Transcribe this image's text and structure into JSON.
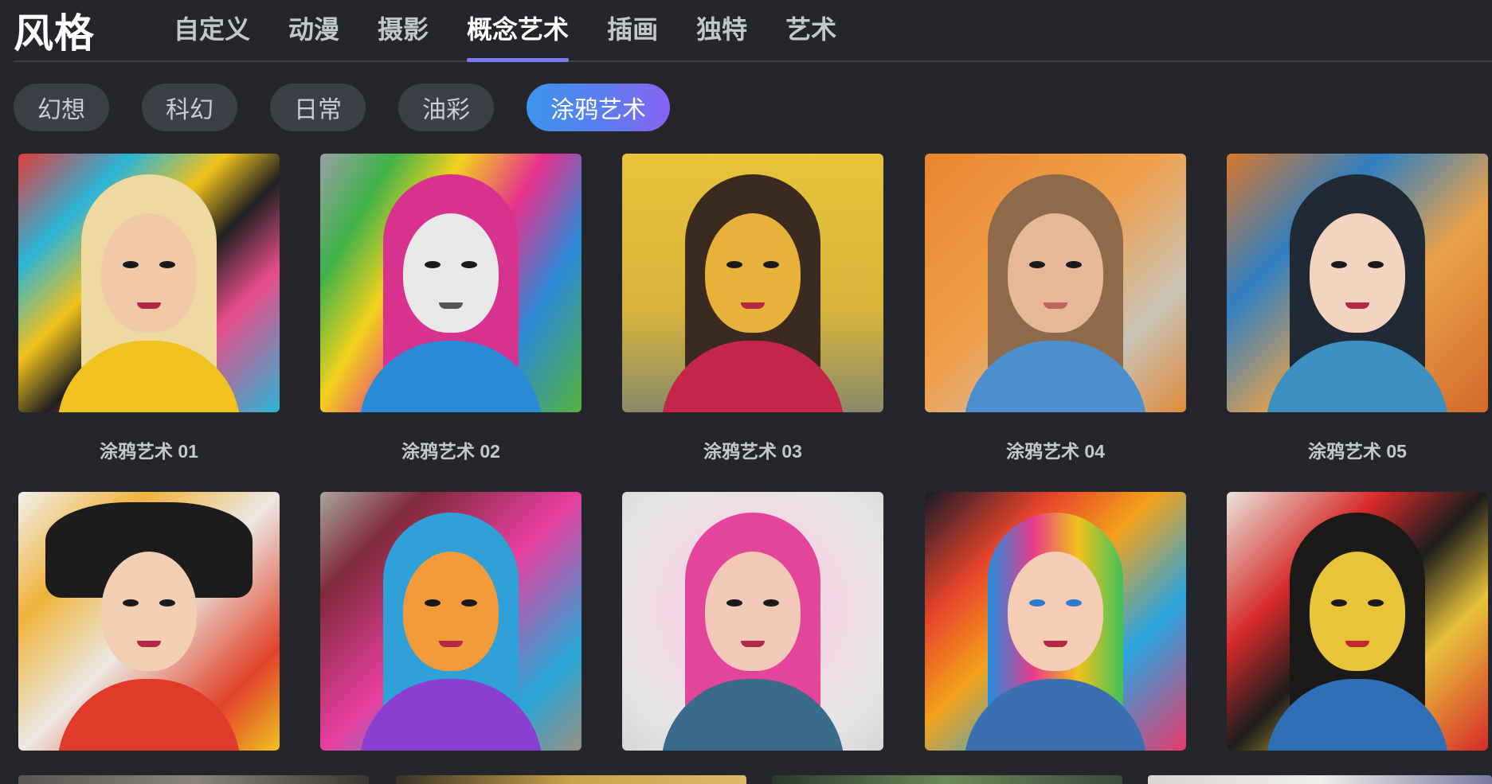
{
  "header": {
    "title": "风格",
    "tabs": [
      {
        "label": "自定义"
      },
      {
        "label": "动漫"
      },
      {
        "label": "摄影"
      },
      {
        "label": "概念艺术",
        "active": true
      },
      {
        "label": "插画"
      },
      {
        "label": "独特"
      },
      {
        "label": "艺术"
      }
    ]
  },
  "chips": [
    {
      "label": "幻想"
    },
    {
      "label": "科幻"
    },
    {
      "label": "日常"
    },
    {
      "label": "油彩"
    },
    {
      "label": "涂鸦艺术",
      "active": true
    }
  ],
  "cards": [
    {
      "caption": "涂鸦艺术 01"
    },
    {
      "caption": "涂鸦艺术 02"
    },
    {
      "caption": "涂鸦艺术 03"
    },
    {
      "caption": "涂鸦艺术 04"
    },
    {
      "caption": "涂鸦艺术 05"
    },
    {
      "caption": ""
    },
    {
      "caption": ""
    },
    {
      "caption": ""
    },
    {
      "caption": ""
    },
    {
      "caption": ""
    }
  ],
  "colors": {
    "background": "#24262b",
    "chip": "#3c3f46",
    "accent_gradient_start": "#3d95ee",
    "accent_gradient_end": "#8a62f1",
    "tab_underline": "#7b7cf4"
  }
}
